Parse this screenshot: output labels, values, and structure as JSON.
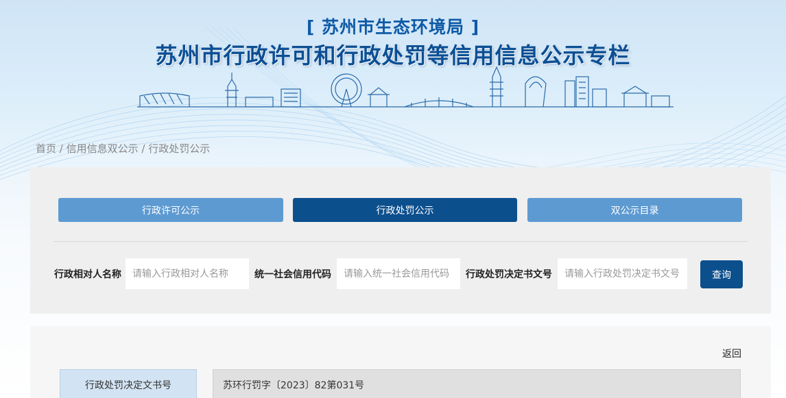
{
  "header": {
    "agency": "[ 苏州市生态环境局 ]",
    "title": "苏州市行政许可和行政处罚等信用信息公示专栏"
  },
  "breadcrumb": {
    "items": [
      "首页",
      "信用信息双公示",
      "行政处罚公示"
    ],
    "separator": " / "
  },
  "tabs": [
    {
      "label": "行政许可公示",
      "active": false
    },
    {
      "label": "行政处罚公示",
      "active": true
    },
    {
      "label": "双公示目录",
      "active": false
    }
  ],
  "search": {
    "fields": [
      {
        "label": "行政相对人名称",
        "placeholder": "请输入行政相对人名称",
        "value": ""
      },
      {
        "label": "统一社会信用代码",
        "placeholder": "请输入统一社会信用代码",
        "value": ""
      },
      {
        "label": "行政处罚决定书文号",
        "placeholder": "请输入行政处罚决定书文号",
        "value": ""
      }
    ],
    "button_label": "查询"
  },
  "detail": {
    "back_label": "返回",
    "rows": [
      {
        "label": "行政处罚决定文书号",
        "value": "苏环行罚字〔2023〕82第031号"
      }
    ]
  },
  "colors": {
    "primary_dark": "#0c4f8d",
    "primary_light": "#5d9ad2",
    "banner_text": "#0b4f94",
    "label_cell": "#d2e3f3"
  }
}
